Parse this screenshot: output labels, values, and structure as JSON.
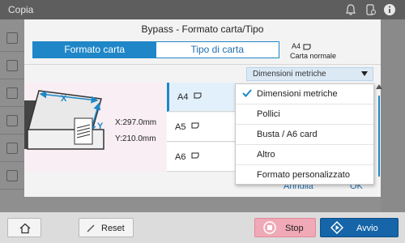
{
  "topbar": {
    "title": "Copia"
  },
  "dialog": {
    "title": "Bypass - Formato carta/Tipo",
    "tabs": [
      "Formato carta",
      "Tipo di carta"
    ],
    "current_paper": {
      "size": "A4",
      "type": "Carta normale"
    },
    "dimensions": {
      "x": "X:297.0mm",
      "y": "Y:210.0mm"
    },
    "preview_labels": {
      "x": "X",
      "y": "Y"
    },
    "sizes": [
      {
        "label": "A4",
        "selected": true
      },
      {
        "label": "A5",
        "selected": false
      },
      {
        "label": "A6",
        "selected": false
      }
    ],
    "buttons": {
      "cancel": "Annulla",
      "ok": "OK"
    }
  },
  "dropdown": {
    "selected": "Dimensioni metriche",
    "options": [
      {
        "label": "Dimensioni metriche",
        "checked": true
      },
      {
        "label": "Pollici",
        "checked": false
      },
      {
        "label": "Busta / A6 card",
        "checked": false
      },
      {
        "label": "Altro",
        "checked": false
      },
      {
        "label": "Formato personalizzato",
        "checked": false
      }
    ]
  },
  "footer": {
    "reset_label": "Reset",
    "stop_label": "Stop",
    "start_label": "Avvio"
  },
  "colors": {
    "accent": "#1f87c8",
    "start_button": "#1565a8",
    "stop_button": "#f0a9b6",
    "preview_bg": "#f8eef4"
  }
}
